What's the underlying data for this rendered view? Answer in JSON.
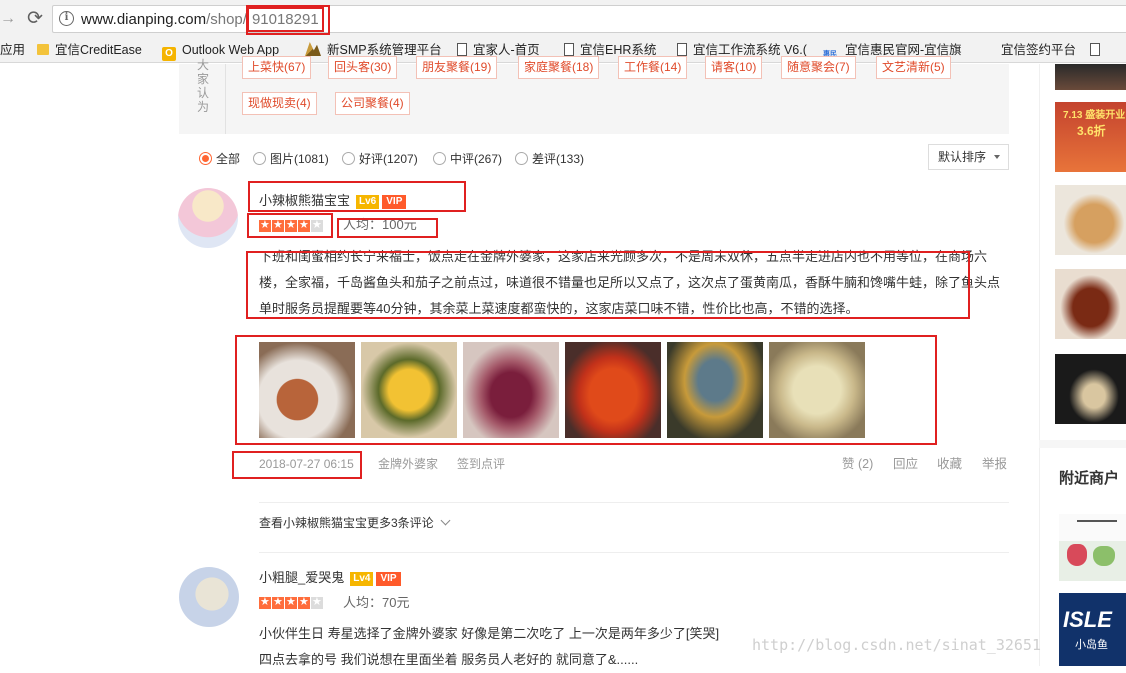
{
  "browser": {
    "url_host": "www.dianping.com",
    "url_path": "/shop/",
    "url_shop_id": "91018291",
    "back_icon": "arrow-left-icon",
    "reload_icon": "reload-icon",
    "info_icon": "info-icon"
  },
  "bookmarks": [
    {
      "label": "应用",
      "icon": "apps-icon"
    },
    {
      "label": "宜信CreditEase",
      "icon": "folder-icon"
    },
    {
      "label": "Outlook Web App",
      "icon": "outlook-icon"
    },
    {
      "label": "新SMP系统管理平台",
      "icon": "smp-icon"
    },
    {
      "label": "宜家人-首页",
      "icon": "page-icon"
    },
    {
      "label": "宜信EHR系统",
      "icon": "page-icon"
    },
    {
      "label": "宜信工作流系统 V6.(",
      "icon": "page-icon"
    },
    {
      "label": "宜信惠民官网-宜信旗",
      "icon": "huimin-icon"
    },
    {
      "label": "宜信签约平台",
      "icon": "none"
    }
  ],
  "impression": {
    "label": "大家认为",
    "tags_row1": [
      "上菜快(67)",
      "回头客(30)",
      "朋友聚餐(19)",
      "家庭聚餐(18)",
      "工作餐(14)",
      "请客(10)",
      "随意聚会(7)",
      "文艺清新(5)"
    ],
    "tags_row2": [
      "现做现卖(4)",
      "公司聚餐(4)"
    ]
  },
  "filters": {
    "options": [
      {
        "label": "全部",
        "selected": true
      },
      {
        "label": "图片(1081)",
        "selected": false
      },
      {
        "label": "好评(1207)",
        "selected": false
      },
      {
        "label": "中评(267)",
        "selected": false
      },
      {
        "label": "差评(133)",
        "selected": false
      }
    ],
    "sort_value": "默认排序"
  },
  "reviews": [
    {
      "username": "小辣椒熊猫宝宝",
      "level": "Lv6",
      "vip": "VIP",
      "rating": 4,
      "avg_price": "人均：100元",
      "text": "下班和闺蜜相约长宁来福士，饭点走在金牌外婆家，这家店来光顾多次，不是周末双休，五点半走进店内也不用等位，在商场六楼，全家福，千岛酱鱼头和茄子之前点过，味道很不错量也足所以又点了，这次点了蛋黄南瓜，香酥牛腩和馋嘴牛蛙，除了鱼头点单时服务员提醒要等40分钟，其余菜上菜速度都蛮快的，这家店菜口味不错，性价比也高，不错的选择。",
      "date": "2018-07-27 06:15",
      "shop": "金牌外婆家",
      "checkin": "签到点评",
      "actions": {
        "like": "赞 (2)",
        "reply": "回应",
        "favorite": "收藏",
        "report": "举报"
      },
      "more": "查看小辣椒熊猫宝宝更多3条评论"
    },
    {
      "username": "小粗腿_爱哭鬼",
      "level": "Lv4",
      "vip": "VIP",
      "rating": 4,
      "avg_price": "人均：70元",
      "text_line1": "小伙伴生日 寿星选择了金牌外婆家 好像是第二次吃了 上一次是两年多少了[笑哭]",
      "text_line2": "四点去拿的号 我们说想在里面坐着 服务员人老好的 就同意了&......"
    }
  ],
  "sidebar": {
    "promo_line1": "7.13 盛装开业",
    "promo_line2": "3.6折",
    "nearby_title": "附近商户",
    "nearby_logo_text": "ISLE",
    "nearby_logo_sub": "小岛鱼",
    "watermark": "http://blog.csdn.net/sinat_32651"
  }
}
